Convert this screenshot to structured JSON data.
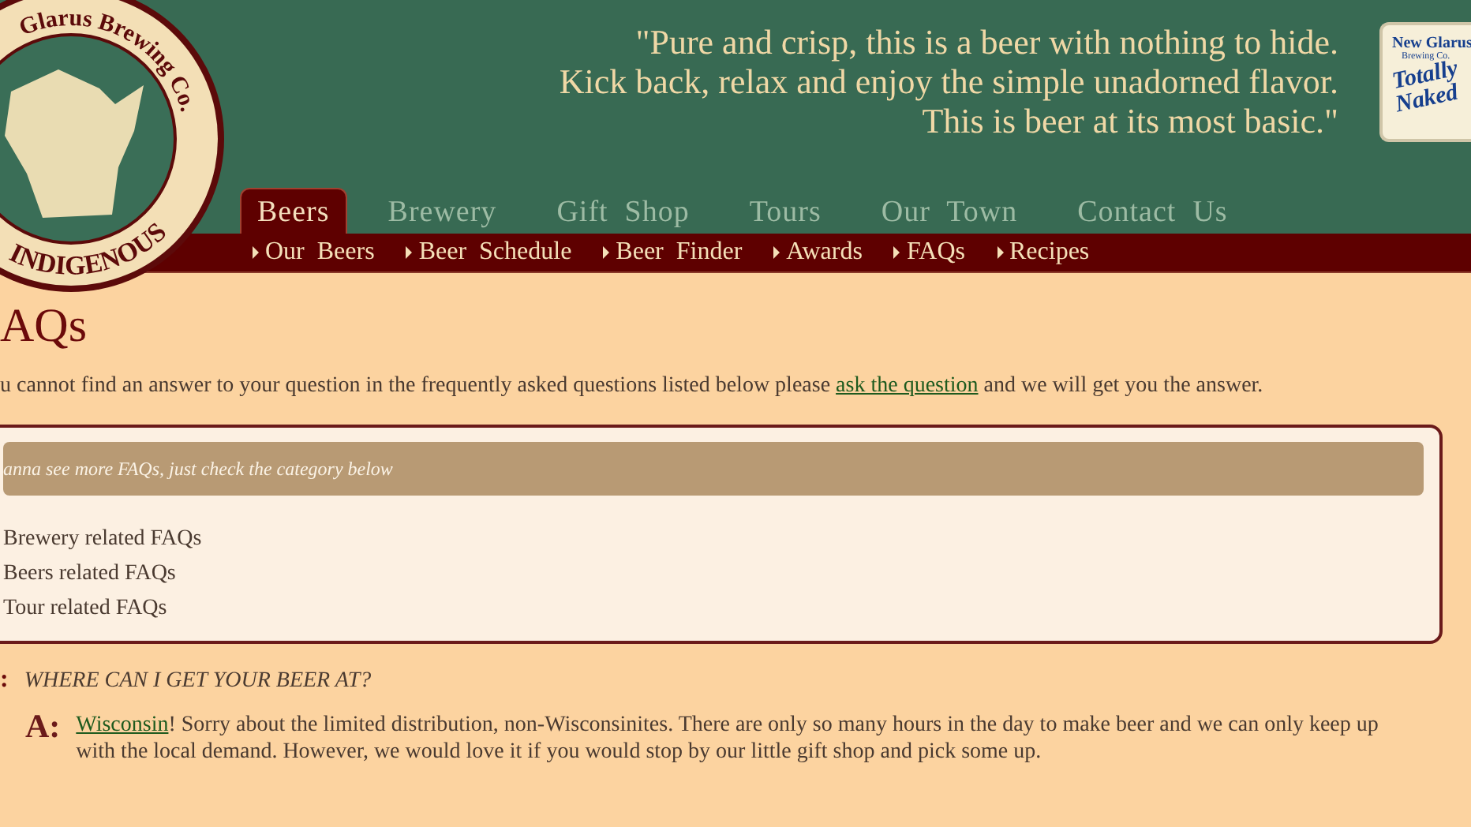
{
  "logo": {
    "top_text": "Glarus Brewing Co.",
    "bottom_text": "INDIGENOUS"
  },
  "quote": [
    "\"Pure and crisp, this is a beer with nothing to hide.",
    "Kick back, relax and enjoy the simple unadorned flavor.",
    "This is beer at its most basic.\""
  ],
  "badge": {
    "brand": "New Glarus",
    "sub": "Brewing Co.",
    "name_1": "Totally",
    "name_2": "Naked"
  },
  "tabs": [
    {
      "label": "Beers",
      "selected": true
    },
    {
      "label": "Brewery",
      "selected": false
    },
    {
      "label": "Gift  Shop",
      "selected": false
    },
    {
      "label": "Tours",
      "selected": false
    },
    {
      "label": "Our  Town",
      "selected": false
    },
    {
      "label": "Contact  Us",
      "selected": false
    }
  ],
  "subnav": [
    "Our  Beers",
    "Beer  Schedule",
    "Beer  Finder",
    "Awards",
    "FAQs",
    "Recipes"
  ],
  "title": "AQs",
  "intro": {
    "before": "u cannot find an answer to your question in the frequently asked questions listed below please",
    "link": "ask the question",
    "after": "and we will get you the answer."
  },
  "categories": {
    "heading": "anna see more FAQs, just check the category below",
    "links": [
      "Brewery related FAQs",
      "Beers related FAQs",
      "Tour related FAQs"
    ]
  },
  "faq": {
    "q_mark": ":",
    "question": "WHERE CAN I GET YOUR BEER AT?",
    "a_mark": "A:",
    "answer_link": "Wisconsin",
    "answer": "! Sorry about the limited distribution, non-Wisconsinites. There are only so many hours in the day to make beer and we can only keep up with the local demand. However, we would love it if you would stop by our little gift shop and pick some up."
  }
}
